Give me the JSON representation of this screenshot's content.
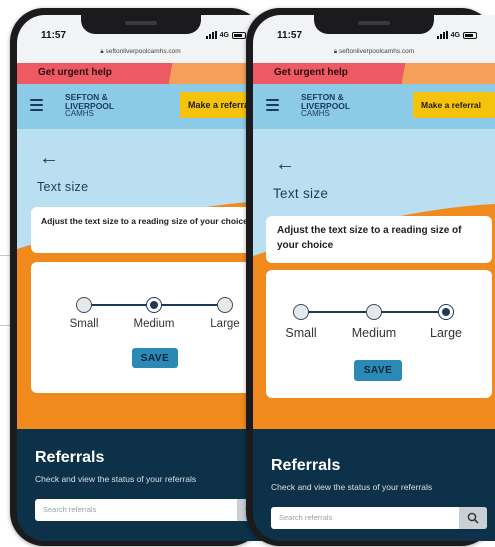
{
  "phones": [
    {
      "time": "11:57",
      "network": "4G",
      "url": "seftonliverpoolcamhs.com",
      "urgent_label": "Get urgent help",
      "logo": {
        "line1": "SEFTON &",
        "line2": "LIVERPOOL",
        "line3": "CAMHS"
      },
      "referral_button": "Make a referral",
      "page_title": "Text size",
      "description": "Adjust the text size to a reading size of your choice",
      "options": [
        "Small",
        "Medium",
        "Large"
      ],
      "selected_option": "Medium",
      "save_label": "SAVE",
      "referrals_title": "Referrals",
      "referrals_subtitle": "Check and view the status of your referrals",
      "search_placeholder": "Search referrals"
    },
    {
      "time": "11:57",
      "network": "4G",
      "url": "seftonliverpoolcamhs.com",
      "urgent_label": "Get urgent help",
      "logo": {
        "line1": "SEFTON &",
        "line2": "LIVERPOOL",
        "line3": "CAMHS"
      },
      "referral_button": "Make a referral",
      "page_title": "Text size",
      "description": "Adjust the text size to a reading size of your choice",
      "options": [
        "Small",
        "Medium",
        "Large"
      ],
      "selected_option": "Large",
      "save_label": "SAVE",
      "referrals_title": "Referrals",
      "referrals_subtitle": "Check and view the status of your referrals",
      "search_placeholder": "Search referrals"
    }
  ],
  "colors": {
    "urgent_red": "#ee5a64",
    "nav_blue": "#8bcbe8",
    "accent_orange": "#f08a1c",
    "referral_yellow": "#f6c30c",
    "save_teal": "#2b8ab5",
    "navy": "#0c3148"
  },
  "icons": [
    "hamburger-icon",
    "back-arrow-icon",
    "search-icon",
    "lock-icon",
    "signal-icon",
    "battery-icon"
  ]
}
